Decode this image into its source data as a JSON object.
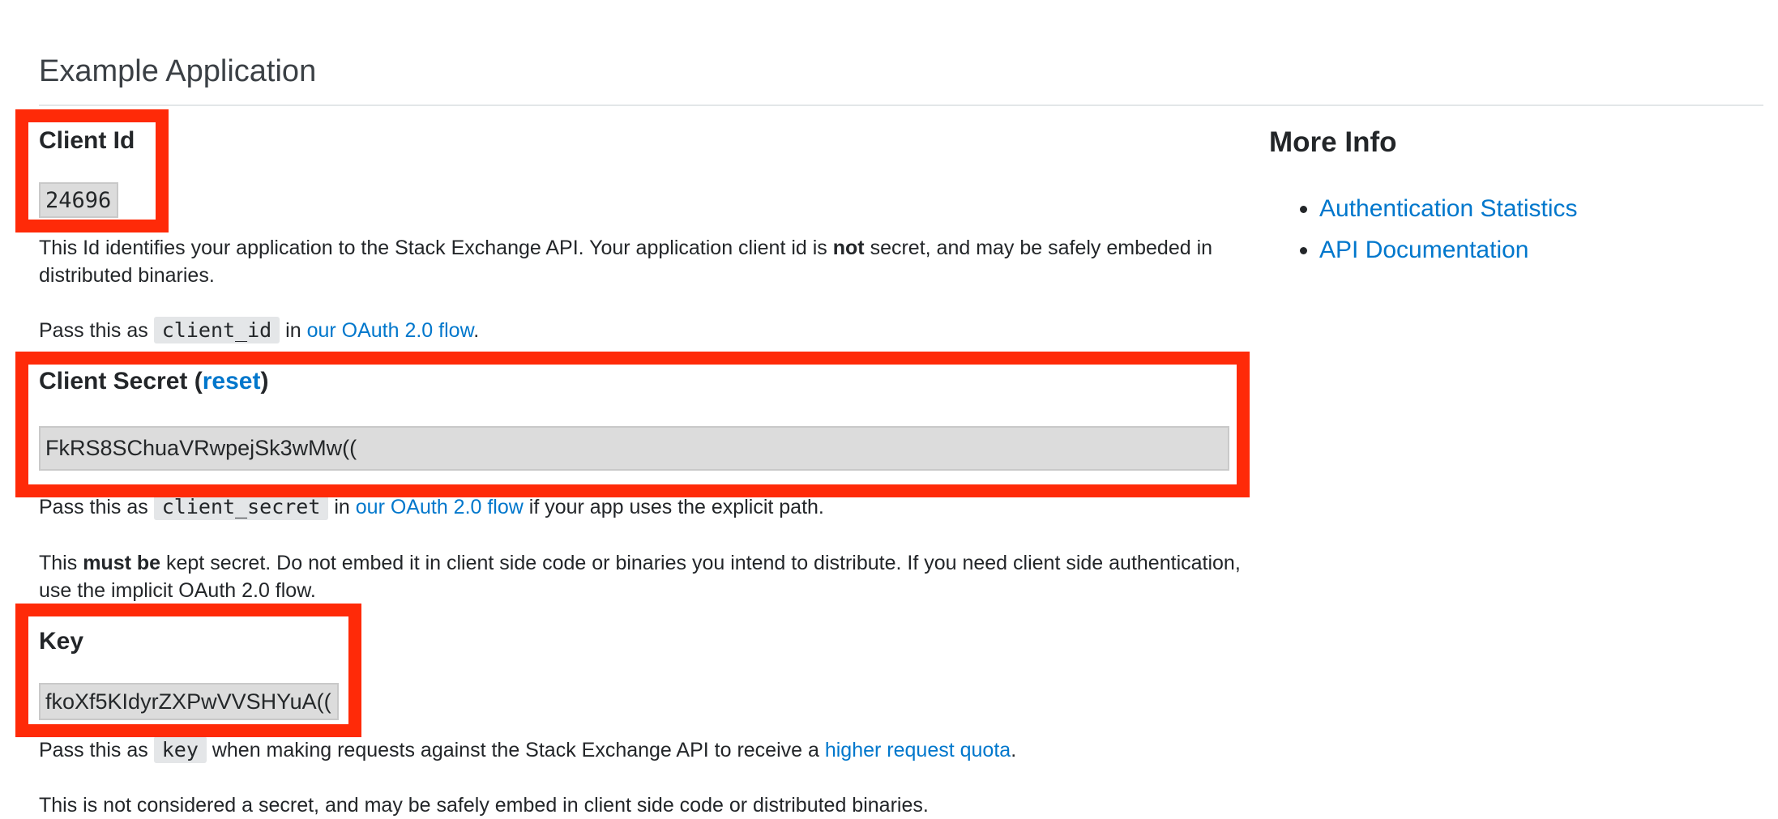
{
  "app": {
    "title": "Example Application"
  },
  "client_id": {
    "label": "Client Id",
    "value": "24696",
    "desc_pre": "This Id identifies your application to the Stack Exchange API. Your application client id is ",
    "desc_bold": "not",
    "desc_post": " secret, and may be safely embeded in distributed binaries.",
    "pass_pre": "Pass this as ",
    "pass_code": "client_id",
    "pass_mid": " in ",
    "pass_link": "our OAuth 2.0 flow",
    "pass_post": "."
  },
  "client_secret": {
    "label_pre": "Client Secret (",
    "reset_link": "reset",
    "label_post": ")",
    "value": "FkRS8SChuaVRwpejSk3wMw((",
    "pass_pre": "Pass this as ",
    "pass_code": "client_secret",
    "pass_mid": " in ",
    "pass_link": "our OAuth 2.0 flow",
    "pass_post": " if your app uses the explicit path.",
    "warn_pre": "This ",
    "warn_bold": "must be",
    "warn_post": " kept secret. Do not embed it in client side code or binaries you intend to distribute. If you need client side authentication, use the implicit OAuth 2.0 flow."
  },
  "key": {
    "label": "Key",
    "value": "fkoXf5KIdyrZXPwVVSHYuA((",
    "pass_pre": "Pass this as ",
    "pass_code": "key",
    "pass_mid": " when making requests against the Stack Exchange API to receive a ",
    "pass_link": "higher request quota",
    "pass_post": ".",
    "note": "This is not considered a secret, and may be safely embed in client side code or distributed binaries."
  },
  "sidebar": {
    "title": "More Info",
    "links": [
      "Authentication Statistics",
      "API Documentation"
    ]
  },
  "colors": {
    "link": "#0077cc",
    "highlight": "#ff2a08",
    "code_bg": "#dcdcdc"
  }
}
